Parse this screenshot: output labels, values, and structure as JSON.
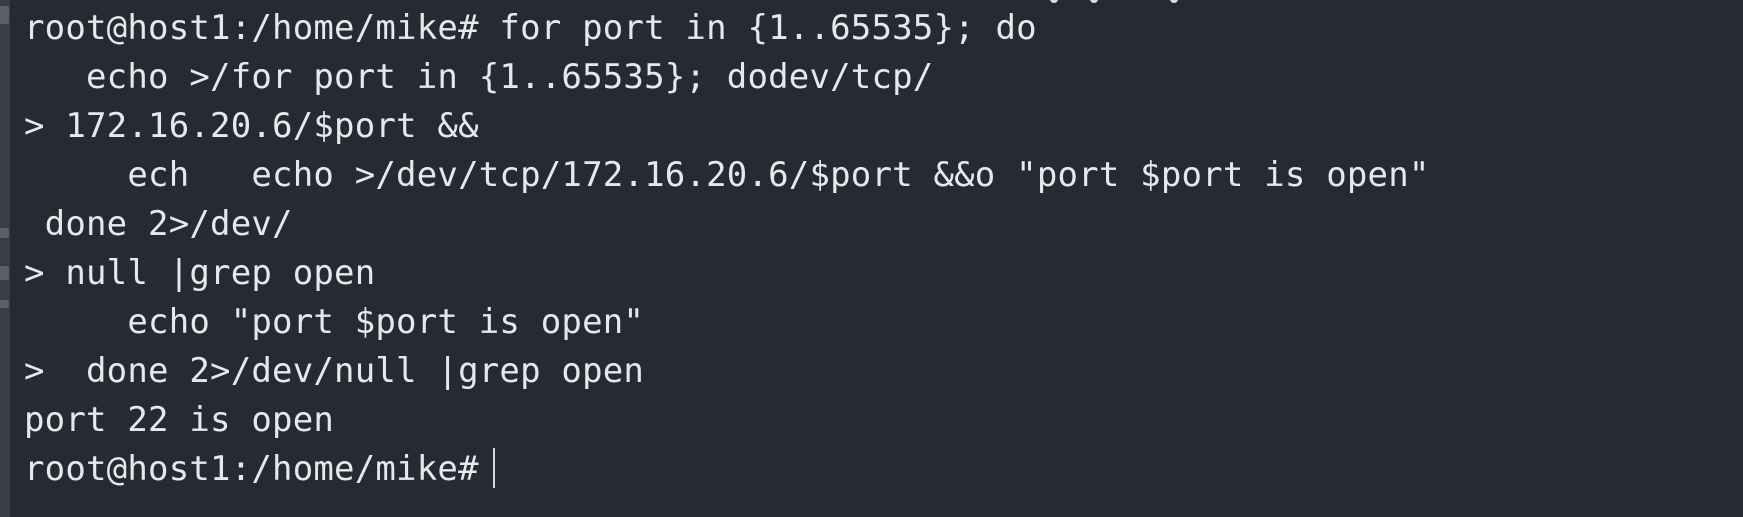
{
  "terminal": {
    "lines": [
      "root@host1:/home/mike# for port in {1..65535}; do",
      "   echo >/for port in {1..65535}; dodev/tcp/",
      "> 172.16.20.6/$port &&",
      "     ech   echo >/dev/tcp/172.16.20.6/$port &&o \"port $port is open\"",
      " done 2>/dev/",
      "> null |grep open",
      "     echo \"port $port is open\"",
      ">  done 2>/dev/null |grep open",
      "port 22 is open",
      "root@host1:/home/mike#"
    ]
  },
  "colors": {
    "background": "#262a33",
    "text": "#e6e8eb"
  }
}
